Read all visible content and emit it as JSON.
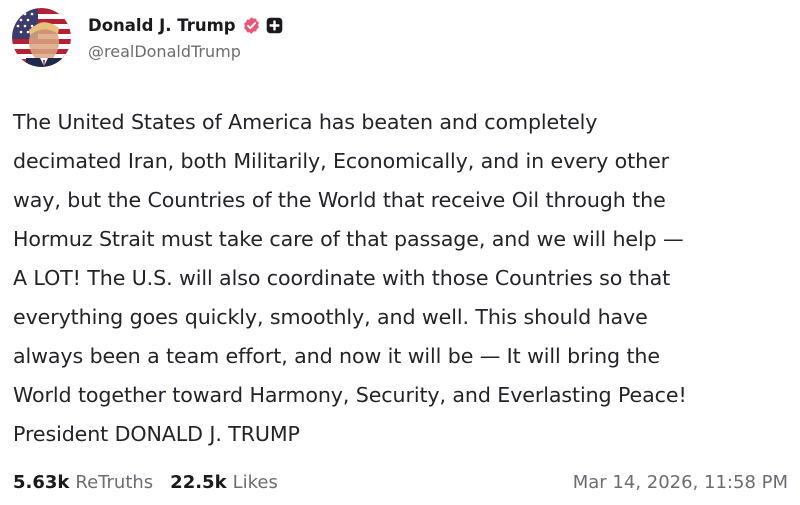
{
  "author": {
    "display_name": "Donald J. Trump",
    "handle": "@realDonaldTrump",
    "verified_icon": "verified-badge-icon",
    "plus_icon": "plus-square-icon",
    "badge_color": "#e8577a"
  },
  "post": {
    "text": "The United States of America has beaten and completely\ndecimated Iran, both Militarily, Economically, and in every other\nway, but the Countries of the World that receive Oil through the\nHormuz Strait must take care of that passage, and we will help —\nA LOT! The U.S. will also coordinate with those Countries so that\neverything goes quickly, smoothly, and well. This should have\nalways been a team effort, and now it will be — It will bring the\nWorld together toward Harmony, Security, and Everlasting Peace!\nPresident DONALD J. TRUMP"
  },
  "stats": {
    "retruths_count": "5.63k",
    "retruths_label": "ReTruths",
    "likes_count": "22.5k",
    "likes_label": "Likes"
  },
  "timestamp": "Mar 14, 2026, 11:58 PM"
}
